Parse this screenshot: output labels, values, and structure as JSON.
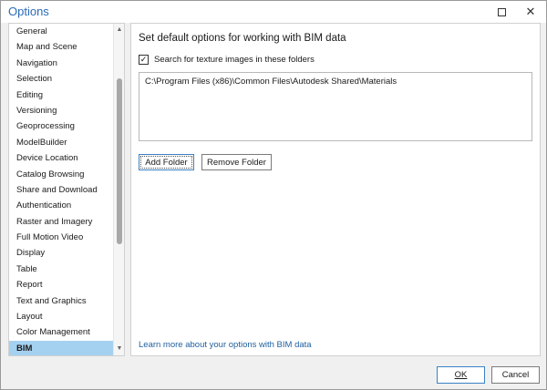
{
  "window": {
    "title": "Options",
    "maximize_icon": "maximize-icon",
    "close_glyph": "✕"
  },
  "sidebar": {
    "items": [
      {
        "label": "General"
      },
      {
        "label": "Map and Scene"
      },
      {
        "label": "Navigation"
      },
      {
        "label": "Selection"
      },
      {
        "label": "Editing"
      },
      {
        "label": "Versioning"
      },
      {
        "label": "Geoprocessing"
      },
      {
        "label": "ModelBuilder"
      },
      {
        "label": "Device Location"
      },
      {
        "label": "Catalog Browsing"
      },
      {
        "label": "Share and Download"
      },
      {
        "label": "Authentication"
      },
      {
        "label": "Raster and Imagery"
      },
      {
        "label": "Full Motion Video"
      },
      {
        "label": "Display"
      },
      {
        "label": "Table"
      },
      {
        "label": "Report"
      },
      {
        "label": "Text and Graphics"
      },
      {
        "label": "Layout"
      },
      {
        "label": "Color Management"
      },
      {
        "label": "BIM"
      }
    ],
    "selected_label": "BIM",
    "scroll_up_glyph": "▲",
    "scroll_down_glyph": "▼"
  },
  "content": {
    "heading": "Set default options for working with BIM data",
    "checkbox_label": "Search for texture images in these folders",
    "checkbox_checked": true,
    "check_glyph": "✓",
    "folders": [
      "C:\\Program Files (x86)\\Common Files\\Autodesk Shared\\Materials"
    ],
    "add_folder_label": "Add Folder",
    "remove_folder_label": "Remove Folder",
    "learn_more_link": "Learn more about your options with BIM data"
  },
  "footer": {
    "ok_label": "OK",
    "cancel_label": "Cancel"
  },
  "colors": {
    "accent": "#2a6ab8",
    "selection": "#a5d1f0",
    "link": "#1f5f9e"
  }
}
